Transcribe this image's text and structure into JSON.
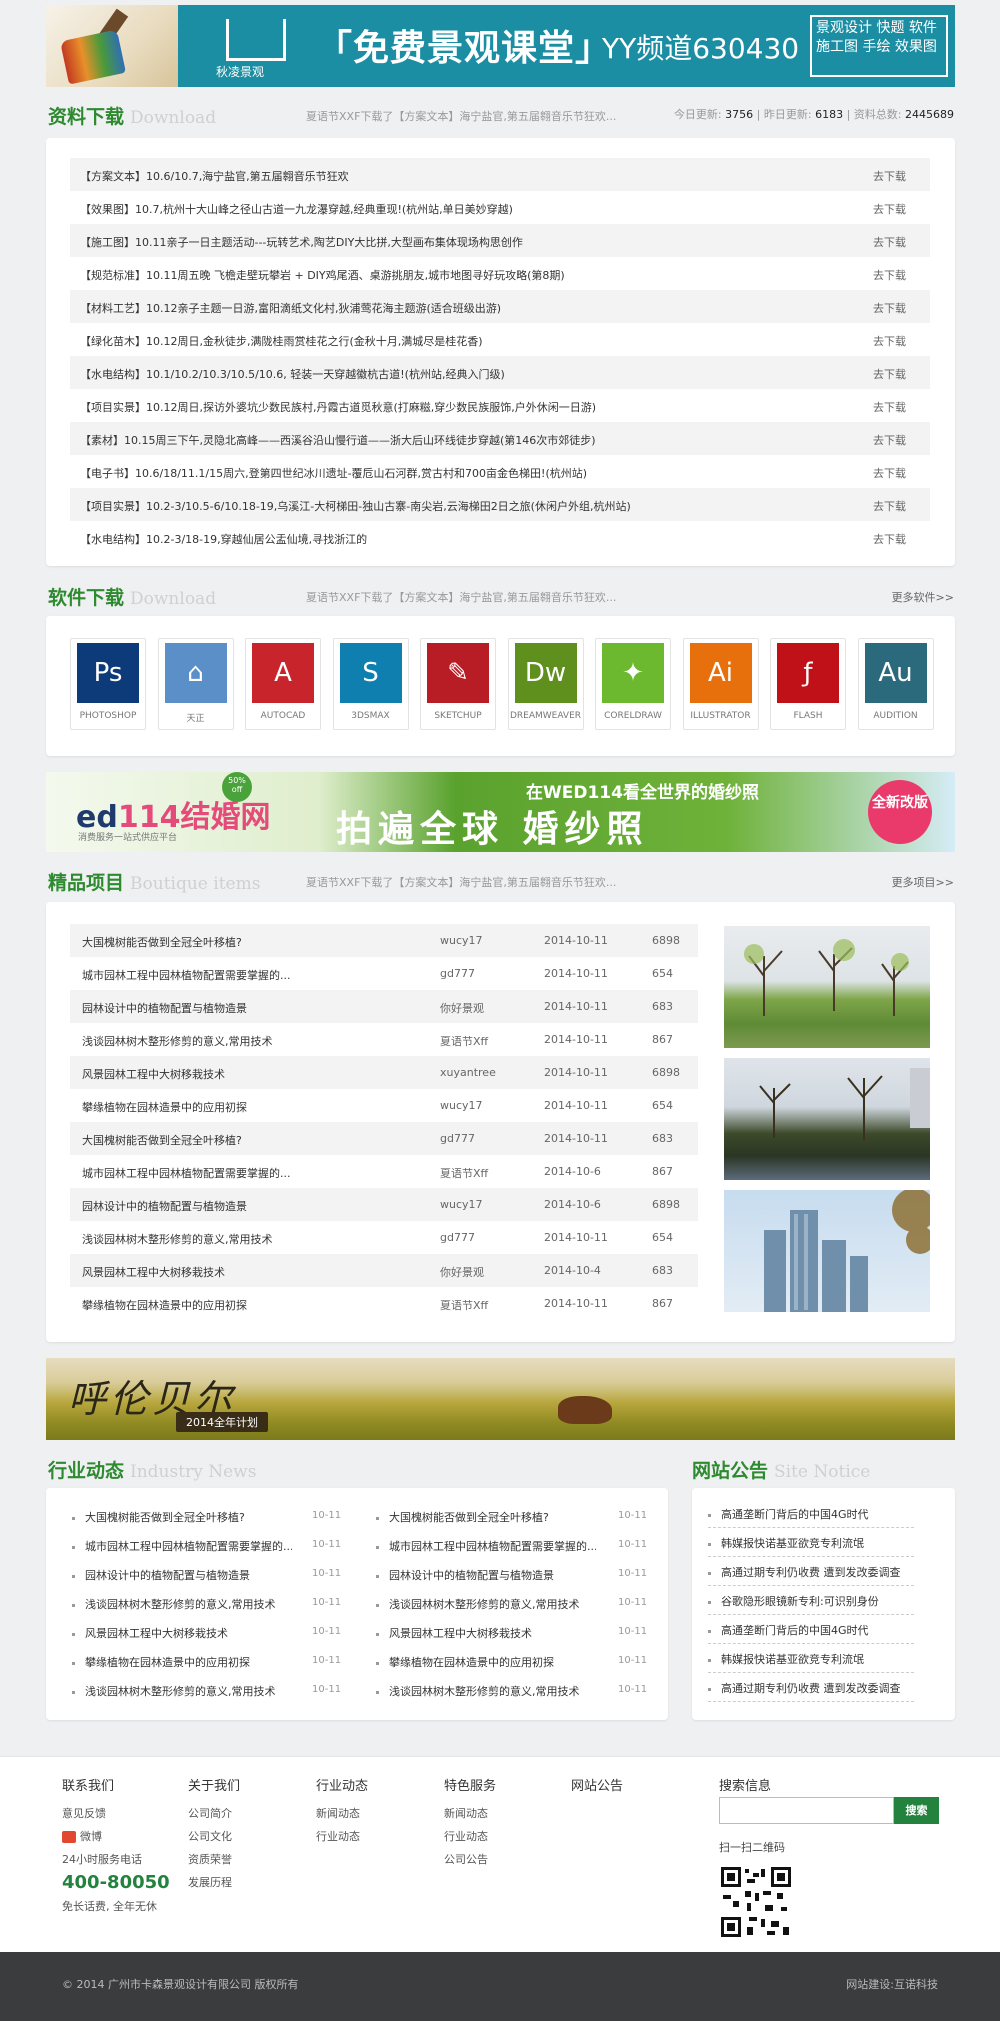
{
  "banner": {
    "logo": "秋凌景观",
    "headline": "「免费景观课堂」",
    "yy": "YY频道630430",
    "box_lines": [
      "景观设计 快题 软件",
      "施工图 手绘 效果图"
    ]
  },
  "downloads": {
    "title": "资料下载",
    "title_en": "Download",
    "ticker": "夏语节XXF下载了【方案文本】海宁盐官,第五届翱音乐节狂欢...",
    "stats_today_label": "今日更新:",
    "stats_today": "3756",
    "stats_yest_label": "昨日更新:",
    "stats_yest": "6183",
    "stats_total_label": "资料总数:",
    "stats_total": "2445689",
    "action": "去下载",
    "rows": [
      "【方案文本】10.6/10.7,海宁盐官,第五届翱音乐节狂欢",
      "【效果图】10.7,杭州十大山峰之径山古道一九龙瀑穿越,经典重现!(杭州站,单日美妙穿越)",
      "【施工图】10.11亲子一日主题活动---玩转艺术,陶艺DIY大比拼,大型画布集体现场构思创作",
      "【规范标准】10.11周五晚 飞檐走壁玩攀岩 + DIY鸡尾酒、桌游挑朋友,城市地图寻好玩攻略(第8期)",
      "【材料工艺】10.12亲子主题一日游,富阳滴纸文化村,狄浦莺花海主题游(适合班级出游)",
      "【绿化苗木】10.12周日,金秋徒步,满陇桂雨赏桂花之行(金秋十月,满城尽是桂花香)",
      "【水电结构】10.1/10.2/10.3/10.5/10.6, 轻装一天穿越徽杭古道!(杭州站,经典入门级)",
      "【项目实景】10.12周日,探访外婆坑少数民族村,丹霞古道觅秋意(打麻糍,穿少数民族服饰,户外休闲一日游)",
      "【素材】10.15周三下午,灵隐北高峰——西溪谷沿山慢行道——浙大后山环线徒步穿越(第146次市郊徒步)",
      "【电子书】10.6/18/11.1/15周六,登第四世纪冰川遗址-覆卮山石河群,赏古村和700亩金色梯田!(杭州站)",
      "【项目实景】10.2-3/10.5-6/10.18-19,乌溪江-大柯梯田-独山古寨-南尖岩,云海梯田2日之旅(休闲户外组,杭州站)",
      "【水电结构】10.2-3/18-19,穿越仙居公盂仙境,寻找浙江的"
    ]
  },
  "software": {
    "title": "软件下载",
    "title_en": "Download",
    "ticker": "夏语节XXF下载了【方案文本】海宁盐官,第五届翱音乐节狂欢...",
    "more": "更多软件>>",
    "items": [
      {
        "glyph": "Ps",
        "label": "PHOTOSHOP",
        "color": "#0d3b7a",
        "icon": "photoshop-icon"
      },
      {
        "glyph": "⌂",
        "label": "天正",
        "color": "#5a8fc8",
        "icon": "tangent-icon"
      },
      {
        "glyph": "A",
        "label": "AUTOCAD",
        "color": "#c8242c",
        "icon": "autocad-icon"
      },
      {
        "glyph": "S",
        "label": "3DSMAX",
        "color": "#0e7fae",
        "icon": "3dsmax-icon"
      },
      {
        "glyph": "✎",
        "label": "SKETCHUP",
        "color": "#b81c25",
        "icon": "sketchup-icon"
      },
      {
        "glyph": "Dw",
        "label": "DREAMWEAVER",
        "color": "#5f8f1d",
        "icon": "dreamweaver-icon"
      },
      {
        "glyph": "✦",
        "label": "CORELDRAW",
        "color": "#6cb82e",
        "icon": "coreldraw-icon"
      },
      {
        "glyph": "Ai",
        "label": "ILLUSTRATOR",
        "color": "#e7700d",
        "icon": "illustrator-icon"
      },
      {
        "glyph": "ƒ",
        "label": "FLASH",
        "color": "#c01018",
        "icon": "flash-icon"
      },
      {
        "glyph": "Au",
        "label": "AUDITION",
        "color": "#2b6a7c",
        "icon": "audition-icon"
      }
    ]
  },
  "ad1": {
    "logo_a": "ed",
    "logo_b": "114结婚网",
    "sub": "消费服务一站式供应平台",
    "badge": "50% off",
    "top": "在WED114看全世界的婚纱照",
    "main": "拍遍全球 婚纱照",
    "circle": "全新改版"
  },
  "projects": {
    "title": "精品项目",
    "title_en": "Boutique items",
    "ticker": "夏语节XXF下载了【方案文本】海宁盐官,第五届翱音乐节狂欢...",
    "more": "更多项目>>",
    "rows": [
      {
        "t": "大国槐树能否做到全冠全叶移植?",
        "u": "wucy17",
        "d": "2014-10-11",
        "n": "6898"
      },
      {
        "t": "城市园林工程中园林植物配置需要掌握的...",
        "u": "gd777",
        "d": "2014-10-11",
        "n": "654"
      },
      {
        "t": "园林设计中的植物配置与植物造景",
        "u": "你好景观",
        "d": "2014-10-11",
        "n": "683"
      },
      {
        "t": "浅谈园林树木整形修剪的意义,常用技术",
        "u": "夏语节Xff",
        "d": "2014-10-11",
        "n": "867"
      },
      {
        "t": "风景园林工程中大树移栽技术",
        "u": "xuyantree",
        "d": "2014-10-11",
        "n": "6898"
      },
      {
        "t": "攀缘植物在园林造景中的应用初探",
        "u": "wucy17",
        "d": "2014-10-11",
        "n": "654"
      },
      {
        "t": "大国槐树能否做到全冠全叶移植?",
        "u": "gd777",
        "d": "2014-10-11",
        "n": "683"
      },
      {
        "t": "城市园林工程中园林植物配置需要掌握的...",
        "u": "夏语节Xff",
        "d": "2014-10-6",
        "n": "867"
      },
      {
        "t": "园林设计中的植物配置与植物造景",
        "u": "wucy17",
        "d": "2014-10-6",
        "n": "6898"
      },
      {
        "t": "浅谈园林树木整形修剪的意义,常用技术",
        "u": "gd777",
        "d": "2014-10-11",
        "n": "654"
      },
      {
        "t": "风景园林工程中大树移栽技术",
        "u": "你好景观",
        "d": "2014-10-4",
        "n": "683"
      },
      {
        "t": "攀缘植物在园林造景中的应用初探",
        "u": "夏语节Xff",
        "d": "2014-10-11",
        "n": "867"
      }
    ]
  },
  "ad2": {
    "title": "呼伦贝尔",
    "plan": "2014全年计划"
  },
  "industry": {
    "title": "行业动态",
    "title_en": "Industry News",
    "left": [
      {
        "t": "大国槐树能否做到全冠全叶移植?",
        "d": "10-11"
      },
      {
        "t": "城市园林工程中园林植物配置需要掌握的...",
        "d": "10-11"
      },
      {
        "t": "园林设计中的植物配置与植物造景",
        "d": "10-11"
      },
      {
        "t": "浅谈园林树木整形修剪的意义,常用技术",
        "d": "10-11"
      },
      {
        "t": "风景园林工程中大树移栽技术",
        "d": "10-11"
      },
      {
        "t": "攀缘植物在园林造景中的应用初探",
        "d": "10-11"
      },
      {
        "t": "浅谈园林树木整形修剪的意义,常用技术",
        "d": "10-11"
      }
    ],
    "right": [
      {
        "t": "大国槐树能否做到全冠全叶移植?",
        "d": "10-11"
      },
      {
        "t": "城市园林工程中园林植物配置需要掌握的...",
        "d": "10-11"
      },
      {
        "t": "园林设计中的植物配置与植物造景",
        "d": "10-11"
      },
      {
        "t": "浅谈园林树木整形修剪的意义,常用技术",
        "d": "10-11"
      },
      {
        "t": "风景园林工程中大树移栽技术",
        "d": "10-11"
      },
      {
        "t": "攀缘植物在园林造景中的应用初探",
        "d": "10-11"
      },
      {
        "t": "浅谈园林树木整形修剪的意义,常用技术",
        "d": "10-11"
      }
    ]
  },
  "notice": {
    "title": "网站公告",
    "title_en": "Site Notice",
    "items": [
      "高通垄断门背后的中国4G时代",
      "韩媒报快诺基亚欲竞专利流氓",
      "高通过期专利仍收费 遭到发改委调查",
      "谷歌隐形眼镜新专利:可识别身份",
      "高通垄断门背后的中国4G时代",
      "韩媒报快诺基亚欲竞专利流氓",
      "高通过期专利仍收费 遭到发改委调查"
    ]
  },
  "footer": {
    "contact": {
      "h": "联系我们",
      "feedback": "意见反馈",
      "weibo": "微博",
      "hotline_label": "24小时服务电话",
      "hotline": "400-80050",
      "free": "免长话费, 全年无休"
    },
    "about": {
      "h": "关于我们",
      "items": [
        "公司简介",
        "公司文化",
        "资质荣誉",
        "发展历程"
      ]
    },
    "industry": {
      "h": "行业动态",
      "items": [
        "新闻动态",
        "行业动态"
      ]
    },
    "special": {
      "h": "特色服务",
      "items": [
        "新闻动态",
        "行业动态",
        "公司公告"
      ]
    },
    "notice": {
      "h": "网站公告"
    },
    "search": {
      "h": "搜索信息",
      "placeholder": "",
      "button": "搜索",
      "qr": "扫一扫二维码"
    },
    "copyright": "© 2014 广州市卡森景观设计有限公司 版权所有",
    "builder": "网站建设:互诺科技"
  }
}
